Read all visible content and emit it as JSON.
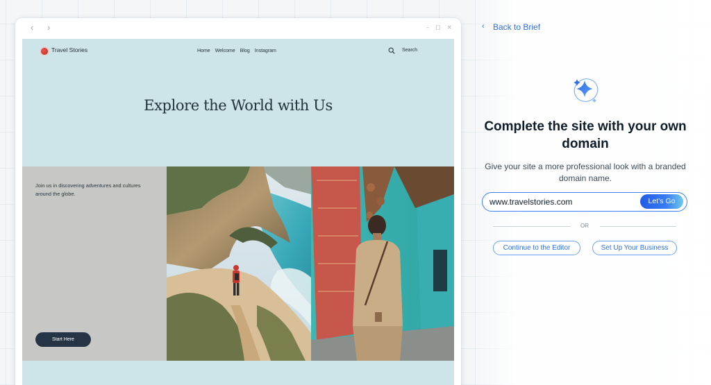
{
  "browser": {
    "back_arrow": "‹",
    "forward_arrow": "›",
    "window_controls": "– ◻ ×"
  },
  "site": {
    "logo_text": "Travel Stories",
    "menu": [
      "Home",
      "Welcome",
      "Blog",
      "Instagram"
    ],
    "search_label": "Search",
    "hero_title": "Explore the World with Us",
    "intro_text": "Join us in discovering adventures and cultures around the globe.",
    "start_button": "Start Here"
  },
  "panel": {
    "back_label": "Back to Brief",
    "title": "Complete the site with your own domain",
    "subtitle": "Give your site a more professional look with a branded domain name.",
    "domain_value": "www.travelstories.com",
    "go_button": "Let’s Go",
    "or_text": "OR",
    "continue_button": "Continue to the Editor",
    "business_button": "Set Up Your Business"
  },
  "colors": {
    "accent": "#2f6fe0",
    "site_background": "#cde5e8",
    "dark_button": "#263545"
  },
  "icons": {
    "back": "chevron-left-icon",
    "search": "search-icon",
    "sparkle": "sparkle-icon",
    "logo": "logo-icon"
  }
}
